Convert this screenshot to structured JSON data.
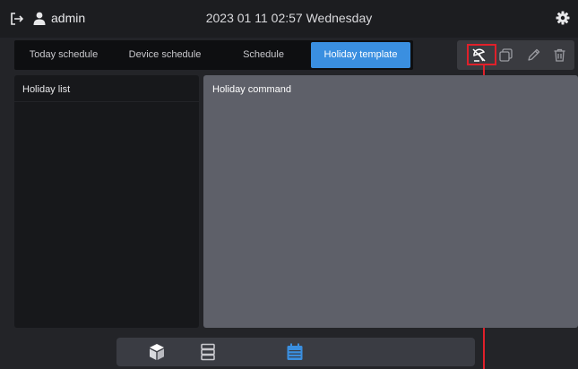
{
  "header": {
    "user_name": "admin",
    "datetime": "2023 01 11 02:57 Wednesday",
    "icons": {
      "logout": "logout-icon",
      "user": "user-icon",
      "settings": "gear-icon"
    }
  },
  "tabs": [
    {
      "label": "Today schedule",
      "active": false
    },
    {
      "label": "Device schedule",
      "active": false
    },
    {
      "label": "Schedule",
      "active": false
    },
    {
      "label": "Holiday template",
      "active": true
    }
  ],
  "toolbar": {
    "icons": [
      "holiday-icon",
      "copy-icon",
      "edit-icon",
      "delete-icon"
    ],
    "highlighted": "holiday-icon"
  },
  "left_panel": {
    "title": "Holiday list"
  },
  "right_panel": {
    "title": "Holiday command"
  },
  "bottom_nav": {
    "items": [
      "device-cube-icon",
      "list-stack-icon",
      "calendar-icon"
    ],
    "active": "calendar-icon"
  },
  "colors": {
    "accent": "#3a8fe0",
    "highlight": "#e0202a",
    "background": "#232428",
    "panel_dark": "#17181b",
    "panel_light": "#5e6069"
  }
}
